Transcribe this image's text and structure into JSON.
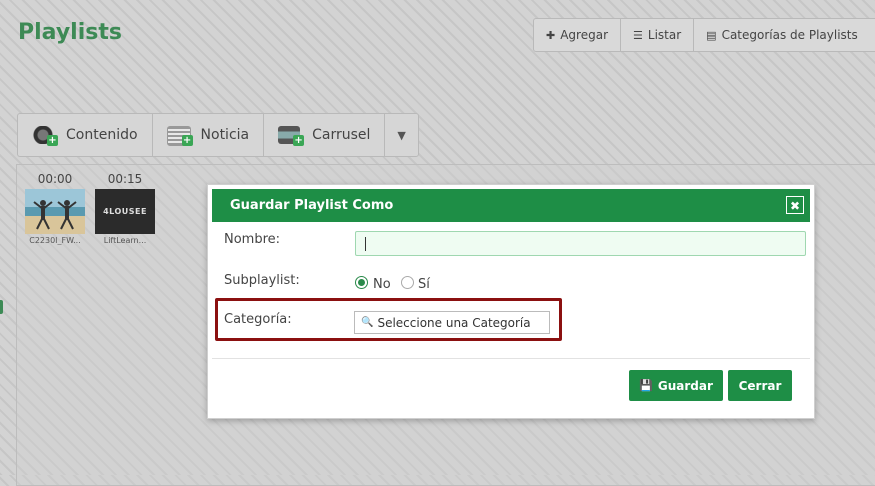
{
  "page": {
    "title": "Playlists"
  },
  "topbar": [
    {
      "icon": "plus-icon",
      "glyph": "✚",
      "label": "Agregar"
    },
    {
      "icon": "list-icon",
      "glyph": "☰",
      "label": "Listar"
    },
    {
      "icon": "list-alt-icon",
      "glyph": "▤",
      "label": "Categorías de Playlists"
    }
  ],
  "media_toolbar": [
    {
      "icon": "film-reel-icon",
      "label": "Contenido"
    },
    {
      "icon": "news-icon",
      "label": "Noticia"
    },
    {
      "icon": "carousel-icon",
      "label": "Carrusel"
    }
  ],
  "media_toolbar_more_glyph": "▼",
  "thumbnails": [
    {
      "time": "00:00",
      "name": "C2230I_FW...",
      "icon": "beach-video-thumbnail"
    },
    {
      "time": "00:15",
      "name": "LiftLearn...",
      "icon": "logo-video-thumbnail"
    }
  ],
  "thumb_logo_text": "4LOUSEE",
  "modal": {
    "title": "Guardar Playlist Como",
    "close_glyph": "✖",
    "name_label": "Nombre:",
    "name_value": "",
    "subplaylist_label": "Subplaylist:",
    "subplaylist_options": [
      "No",
      "Sí"
    ],
    "subplaylist_selected": "No",
    "category_label": "Categoría:",
    "category_placeholder": "Seleccione una Categoría",
    "search_glyph": "🔍",
    "save_label": "Guardar",
    "save_glyph": "💾",
    "close_label": "Cerrar"
  },
  "colors": {
    "accent": "#1e8e46",
    "title_green": "#3d8a55",
    "highlight_border": "#8b1010"
  }
}
